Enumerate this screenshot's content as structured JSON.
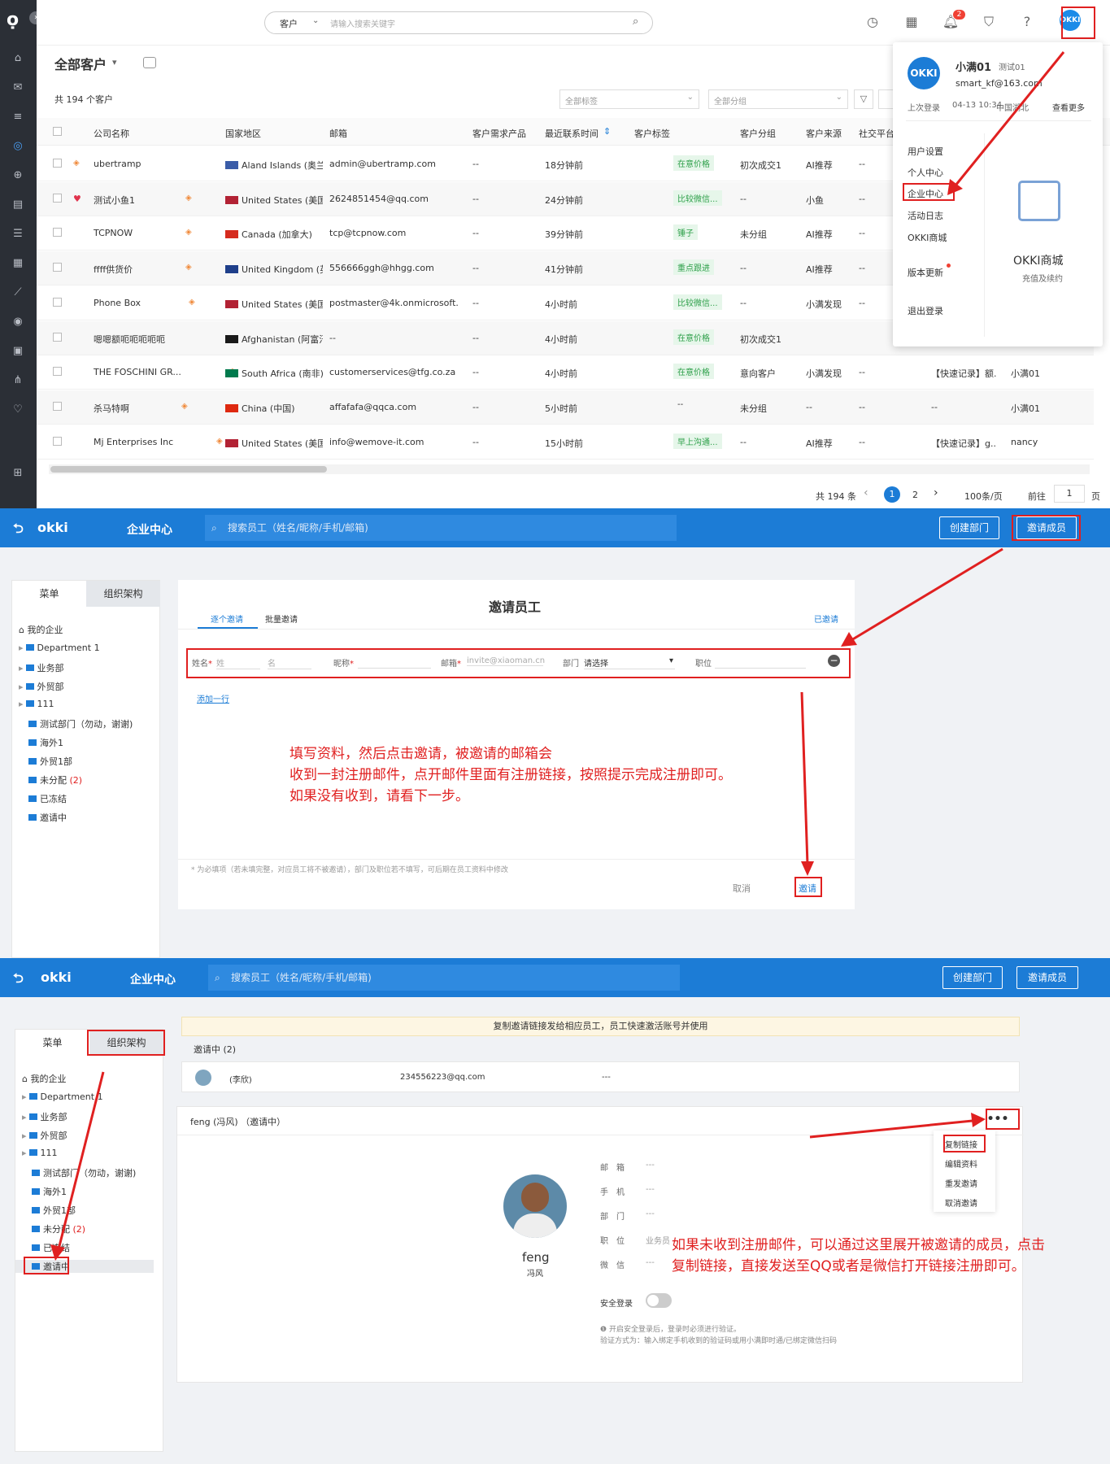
{
  "top": {
    "search_select": "客户",
    "search_placeholder": "请输入搜索关键字",
    "notification_count": "2"
  },
  "customers": {
    "title": "全部客户",
    "count": "共 194 个客户",
    "tag_filter": "全部标签",
    "group_filter": "全部分组",
    "columns": [
      "公司名称",
      "国家地区",
      "邮箱",
      "客户需求产品",
      "最近联系时间",
      "客户标签",
      "客户分组",
      "客户来源",
      "社交平台"
    ],
    "rows": [
      {
        "name": "ubertramp",
        "country": "Aland Islands (奥兰群",
        "email": "admin@ubertramp.com",
        "need": "--",
        "time": "18分钟前",
        "tag": "在意价格",
        "group": "初次成交1",
        "source": "AI推荐",
        "social": "--",
        "record": "",
        "owner": ""
      },
      {
        "name": "测试小鱼1",
        "country": "United States (美国)",
        "email": "2624851454@qq.com",
        "need": "--",
        "time": "24分钟前",
        "tag": "比较微信...",
        "group": "--",
        "source": "小鱼",
        "social": "--",
        "record": "",
        "owner": ""
      },
      {
        "name": "TCPNOW",
        "country": "Canada (加拿大)",
        "email": "tcp@tcpnow.com",
        "need": "--",
        "time": "39分钟前",
        "tag": "锤子",
        "group": "未分组",
        "source": "AI推荐",
        "social": "--",
        "record": "",
        "owner": ""
      },
      {
        "name": "ffff供货价",
        "country": "United Kingdom (英",
        "email": "556666ggh@hhgg.com",
        "need": "--",
        "time": "41分钟前",
        "tag": "重点跟进",
        "group": "--",
        "source": "AI推荐",
        "social": "--",
        "record": "",
        "owner": ""
      },
      {
        "name": "Phone Box",
        "country": "United States (美国)",
        "email": "postmaster@4k.onmicrosoft....",
        "need": "--",
        "time": "4小时前",
        "tag": "比较微信...",
        "group": "--",
        "source": "小满发现",
        "social": "--",
        "record": "",
        "owner": ""
      },
      {
        "name": "嗯嗯额呃呃呃呃呃",
        "country": "Afghanistan (阿富汗",
        "email": "--",
        "need": "--",
        "time": "4小时前",
        "tag": "在意价格",
        "group": "初次成交1",
        "source": "",
        "social": "",
        "record": "",
        "owner": ""
      },
      {
        "name": "THE FOSCHINI GR...",
        "country": "South Africa (南非)...",
        "email": "customerservices@tfg.co.za",
        "need": "--",
        "time": "4小时前",
        "tag": "在意价格",
        "group": "意向客户",
        "source": "小满发现",
        "social": "--",
        "record": "【快速记录】额.",
        "owner": "小满01"
      },
      {
        "name": "杀马特啊",
        "country": "China (中国)",
        "email": "affafafa@qqca.com",
        "need": "--",
        "time": "5小时前",
        "tag": "--",
        "group": "未分组",
        "source": "--",
        "social": "--",
        "record": "--",
        "owner": "小满01"
      },
      {
        "name": "Mj Enterprises Inc",
        "country": "United States (美国)",
        "email": "info@wemove-it.com",
        "need": "--",
        "time": "15小时前",
        "tag": "早上沟通...",
        "group": "--",
        "source": "AI推荐",
        "social": "--",
        "record": "【快速记录】g...",
        "owner": "nancy"
      }
    ],
    "pager": {
      "total": "共 194 条",
      "p1": "1",
      "p2": "2",
      "size": "100条/页",
      "goto": "前往",
      "page": "1",
      "unit": "页"
    }
  },
  "usermenu": {
    "name": "小满01",
    "tag": "测试01",
    "email": "smart_kf@163.com",
    "last_login_label": "上次登录",
    "last_login": "04-13 10:34",
    "location": "中国湖北",
    "more": "查看更多",
    "items": [
      "用户设置",
      "个人中心",
      "企业中心",
      "活动日志",
      "OKKI商城",
      "版本更新",
      "退出登录"
    ],
    "shop_title": "OKKI商城",
    "shop_sub": "充值及续约"
  },
  "enterprise": {
    "logo": "okki",
    "title": "企业中心",
    "search": "搜索员工（姓名/昵称/手机/邮箱)",
    "create_dept": "创建部门",
    "invite_member": "邀请成员"
  },
  "side": {
    "tab_menu": "菜单",
    "tab_org": "组织架构",
    "root": "我的企业",
    "nodes": [
      "Department 1",
      "业务部",
      "外贸部",
      "111",
      "测试部门（勿动，谢谢)",
      "海外1",
      "外贸1部",
      "未分配",
      "已冻结",
      "邀请中"
    ],
    "unassigned_count": "(2)"
  },
  "invite": {
    "title": "邀请员工",
    "tab_single": "逐个邀请",
    "tab_batch": "批量邀请",
    "invited": "已邀请",
    "name_label": "姓名",
    "last_ph": "姓",
    "first_ph": "名",
    "nick_label": "昵称",
    "email_label": "邮箱",
    "email_ph": "invite@xiaoman.cn",
    "dept_label": "部门",
    "dept_ph": "请选择",
    "pos_label": "职位",
    "add_row": "添加一行",
    "note": "* 为必填项（若未填完整，对应员工将不被邀请），部门及职位若不填写，可后期在员工资料中修改",
    "cancel": "取消",
    "submit": "邀请"
  },
  "ann1": [
    "填写资料，然后点击邀请，被邀请的邮箱会",
    "收到一封注册邮件，点开邮件里面有注册链接，按照提示完成注册即可。",
    "如果没有收到，请看下一步。"
  ],
  "pending": {
    "banner": "复制邀请链接发给相应员工，员工快速激活账号并使用",
    "header": "邀请中 (2)",
    "row1_name": "(李欣)",
    "row1_email": "234556223@qq.com",
    "row1_dash": "---",
    "detail_title": "feng (冯风) （邀请中）",
    "name": "feng",
    "cn_name": "冯风",
    "fields": [
      {
        "label": "邮　箱",
        "value": "---"
      },
      {
        "label": "手　机",
        "value": "---"
      },
      {
        "label": "部　门",
        "value": "---"
      },
      {
        "label": "职　位",
        "value": "业务员"
      },
      {
        "label": "微　信",
        "value": "---"
      }
    ],
    "safe_label": "安全登录",
    "safe_note1": "开启安全登录后，登录时必须进行验证。",
    "safe_note2": "验证方式为：输入绑定手机收到的验证码或用小满即时通/已绑定微信扫码",
    "actions": [
      "复制链接",
      "编辑资料",
      "重发邀请",
      "取消邀请"
    ]
  },
  "ann2": [
    "如果未收到注册邮件，可以通过这里展开被邀请的成员，点击",
    "复制链接，直接发送至QQ或者是微信打开链接注册即可。"
  ]
}
